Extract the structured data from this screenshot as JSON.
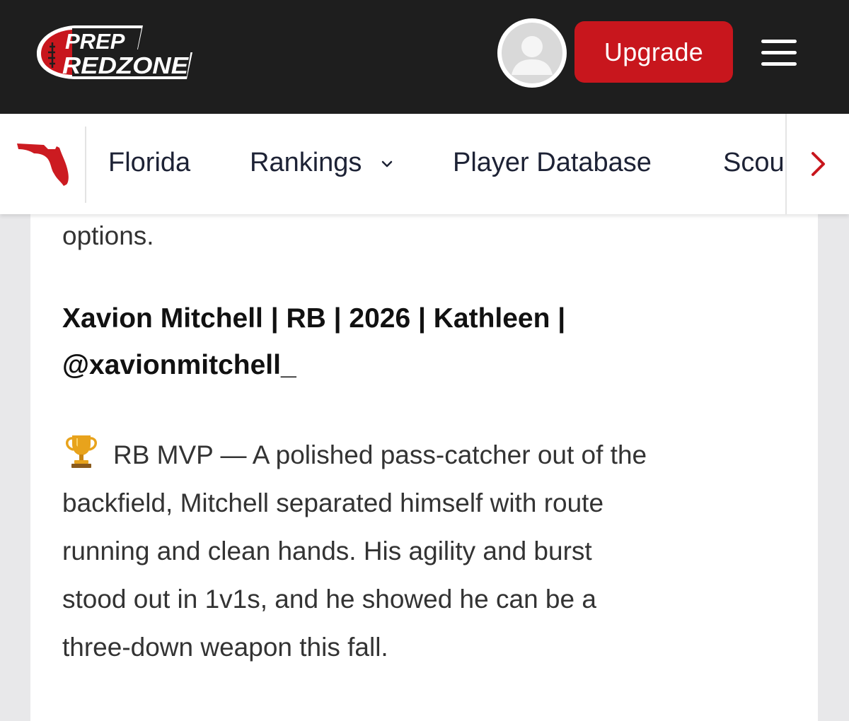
{
  "header": {
    "logo_line1": "PREP",
    "logo_line2": "REDZONE",
    "upgrade_label": "Upgrade"
  },
  "nav": {
    "items": [
      {
        "label": "Florida"
      },
      {
        "label": "Rankings"
      },
      {
        "label": "Player Database"
      },
      {
        "label": "Scou"
      }
    ]
  },
  "article": {
    "previous_text": "options.",
    "headline_line1": "Xavion Mitchell | RB | 2026 | Kathleen |",
    "headline_line2": "@xavionmitchell_",
    "body_line1": "RB MVP — A polished pass-catcher out of the",
    "body_line2": "backfield, Mitchell separated himself with route",
    "body_line3": "running and clean hands. His agility and burst",
    "body_line4": "stood out in 1v1s, and he showed he can be a",
    "body_line5": "three-down weapon this fall."
  },
  "colors": {
    "topbar": "#1e1e1e",
    "brand_red": "#c8161d",
    "nav_text": "#1d2235",
    "body_text": "#333333"
  },
  "icons": {
    "avatar": "default-user-avatar",
    "menu": "hamburger-menu-icon",
    "state": "florida-state-icon",
    "dropdown": "chevron-down-icon",
    "scroll": "chevron-right-icon",
    "emoji": "trophy-icon"
  }
}
